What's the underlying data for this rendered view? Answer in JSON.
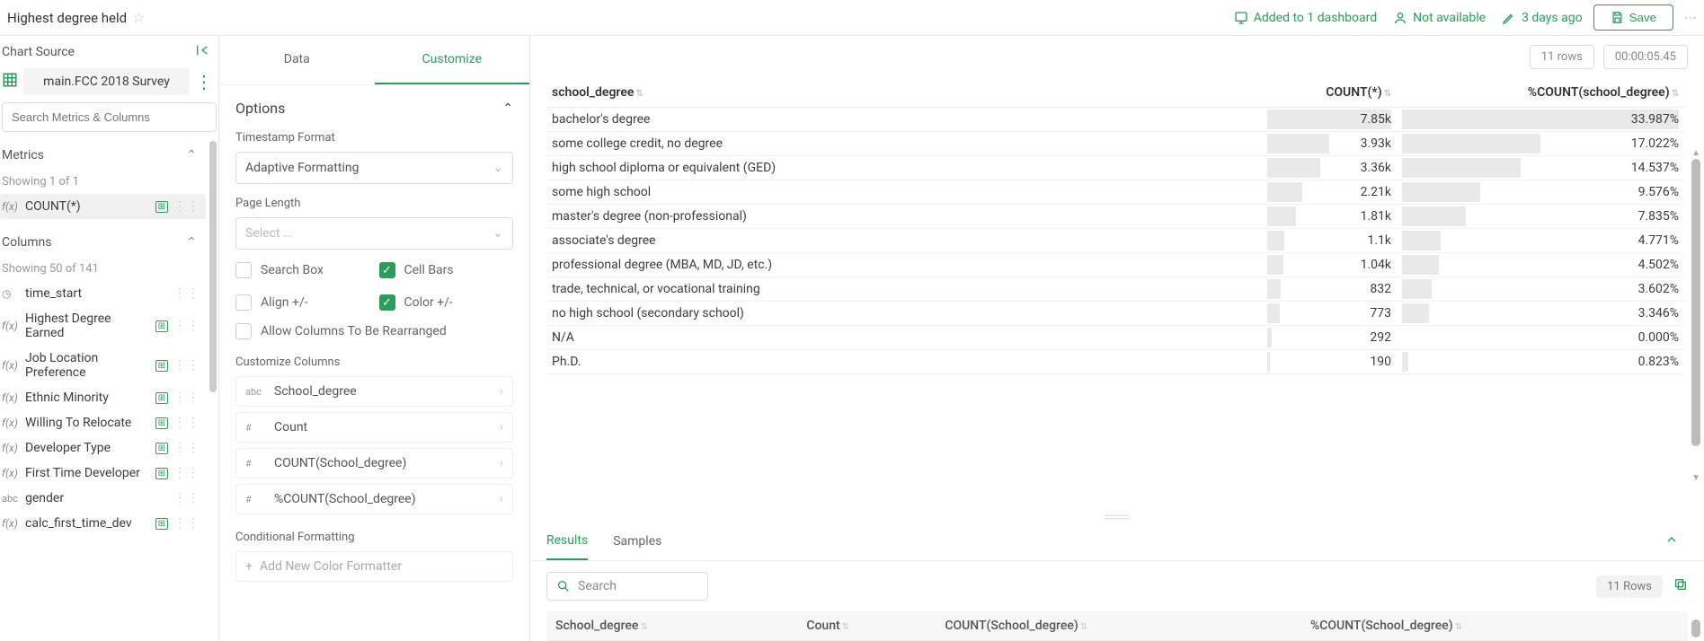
{
  "header": {
    "title": "Highest degree held",
    "dashboards": "Added to 1 dashboard",
    "availability": "Not available",
    "updated": "3 days ago",
    "save": "Save"
  },
  "sidebar": {
    "chart_source_label": "Chart Source",
    "source_name": "main.FCC 2018 Survey",
    "search_placeholder": "Search Metrics & Columns",
    "metrics_label": "Metrics",
    "metrics_showing": "Showing 1 of 1",
    "metric": "COUNT(*)",
    "columns_label": "Columns",
    "columns_showing": "Showing 50 of 141",
    "columns": [
      {
        "t": "clock",
        "label": "time_start",
        "agg": false
      },
      {
        "t": "fx",
        "label": "Highest Degree Earned",
        "agg": true
      },
      {
        "t": "fx",
        "label": "Job Location Preference",
        "agg": true
      },
      {
        "t": "fx",
        "label": "Ethnic Minority",
        "agg": true
      },
      {
        "t": "fx",
        "label": "Willing To Relocate",
        "agg": true
      },
      {
        "t": "fx",
        "label": "Developer Type",
        "agg": true
      },
      {
        "t": "fx",
        "label": "First Time Developer",
        "agg": true
      },
      {
        "t": "abc",
        "label": "gender",
        "agg": false
      },
      {
        "t": "fx",
        "label": "calc_first_time_dev",
        "agg": true
      }
    ]
  },
  "tabs": {
    "data": "Data",
    "customize": "Customize"
  },
  "options": {
    "heading": "Options",
    "timestamp_label": "Timestamp Format",
    "timestamp_value": "Adaptive Formatting",
    "page_length_label": "Page Length",
    "page_length_placeholder": "Select ...",
    "search_box": "Search Box",
    "cell_bars": "Cell Bars",
    "align": "Align +/-",
    "color": "Color +/-",
    "rearrange": "Allow Columns To Be Rearranged",
    "customize_columns": "Customize Columns",
    "cols": [
      {
        "typ": "abc",
        "label": "School_degree"
      },
      {
        "typ": "#",
        "label": "Count"
      },
      {
        "typ": "#",
        "label": "COUNT(School_degree)"
      },
      {
        "typ": "#",
        "label": "%COUNT(School_degree)"
      }
    ],
    "cond_format": "Conditional Formatting",
    "add_formatter": "Add New Color Formatter"
  },
  "result_meta": {
    "rows": "11 rows",
    "time": "00:00:05.45"
  },
  "chart_data": {
    "type": "table",
    "columns": [
      "school_degree",
      "COUNT(*)",
      "%COUNT(school_degree)"
    ],
    "rows": [
      {
        "degree": "bachelor's degree",
        "count_label": "7.85k",
        "count": 7850,
        "pct_label": "33.987%",
        "pct": 33.987
      },
      {
        "degree": "some college credit, no degree",
        "count_label": "3.93k",
        "count": 3930,
        "pct_label": "17.022%",
        "pct": 17.022
      },
      {
        "degree": "high school diploma or equivalent (GED)",
        "count_label": "3.36k",
        "count": 3360,
        "pct_label": "14.537%",
        "pct": 14.537
      },
      {
        "degree": "some high school",
        "count_label": "2.21k",
        "count": 2210,
        "pct_label": "9.576%",
        "pct": 9.576
      },
      {
        "degree": "master's degree (non-professional)",
        "count_label": "1.81k",
        "count": 1810,
        "pct_label": "7.835%",
        "pct": 7.835
      },
      {
        "degree": "associate's degree",
        "count_label": "1.1k",
        "count": 1100,
        "pct_label": "4.771%",
        "pct": 4.771
      },
      {
        "degree": "professional degree (MBA, MD, JD, etc.)",
        "count_label": "1.04k",
        "count": 1040,
        "pct_label": "4.502%",
        "pct": 4.502
      },
      {
        "degree": "trade, technical, or vocational training",
        "count_label": "832",
        "count": 832,
        "pct_label": "3.602%",
        "pct": 3.602
      },
      {
        "degree": "no high school (secondary school)",
        "count_label": "773",
        "count": 773,
        "pct_label": "3.346%",
        "pct": 3.346
      },
      {
        "degree": "N/A",
        "count_label": "292",
        "count": 292,
        "pct_label": "0.000%",
        "pct": 0.0
      },
      {
        "degree": "Ph.D.",
        "count_label": "190",
        "count": 190,
        "pct_label": "0.823%",
        "pct": 0.823
      }
    ]
  },
  "bottom": {
    "results": "Results",
    "samples": "Samples",
    "search_placeholder": "Search",
    "rows_badge": "11 Rows",
    "headers": [
      "School_degree",
      "Count",
      "COUNT(School_degree)",
      "%COUNT(School_degree)"
    ]
  }
}
